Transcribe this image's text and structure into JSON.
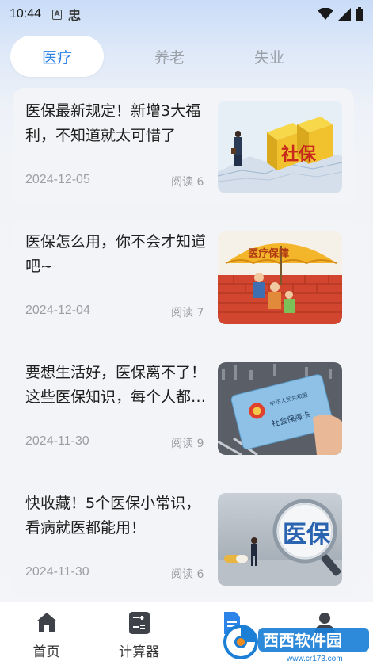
{
  "status_bar": {
    "time": "10:44",
    "app_icon_1": "A",
    "app_icon_2": "忠"
  },
  "tabs": [
    {
      "label": "医疗",
      "active": true
    },
    {
      "label": "养老",
      "active": false
    },
    {
      "label": "失业",
      "active": false
    }
  ],
  "articles": [
    {
      "title": "医保最新规定！新增3大福利，不知道就太可惜了",
      "date": "2024-12-05",
      "reads": "阅读 6",
      "image": "social-security-blocks-image",
      "image_text": "社保"
    },
    {
      "title": "医保怎么用，你不会才知道吧~",
      "date": "2024-12-04",
      "reads": "阅读 7",
      "image": "medical-umbrella-image",
      "image_text": "医疗保障"
    },
    {
      "title": "要想生活好，医保离不了！这些医保知识，每个人都应该知道",
      "date": "2024-11-30",
      "reads": "阅读 9",
      "image": "insurance-card-image",
      "image_text": "社会保障卡"
    },
    {
      "title": "快收藏！5个医保小常识，看病就医都能用！",
      "date": "2024-11-30",
      "reads": "阅读 6",
      "image": "magnifier-image",
      "image_text": "医保"
    }
  ],
  "bottom_nav": [
    {
      "label": "首页",
      "icon": "home-icon"
    },
    {
      "label": "计算器",
      "icon": "calculator-icon"
    },
    {
      "label": "",
      "icon": "news-icon"
    },
    {
      "label": "",
      "icon": "profile-icon"
    }
  ],
  "watermark": {
    "brand": "西西软件园",
    "url": "www.cr173.com"
  },
  "colors": {
    "accent": "#2c83e8",
    "muted": "#9b9ea3"
  }
}
